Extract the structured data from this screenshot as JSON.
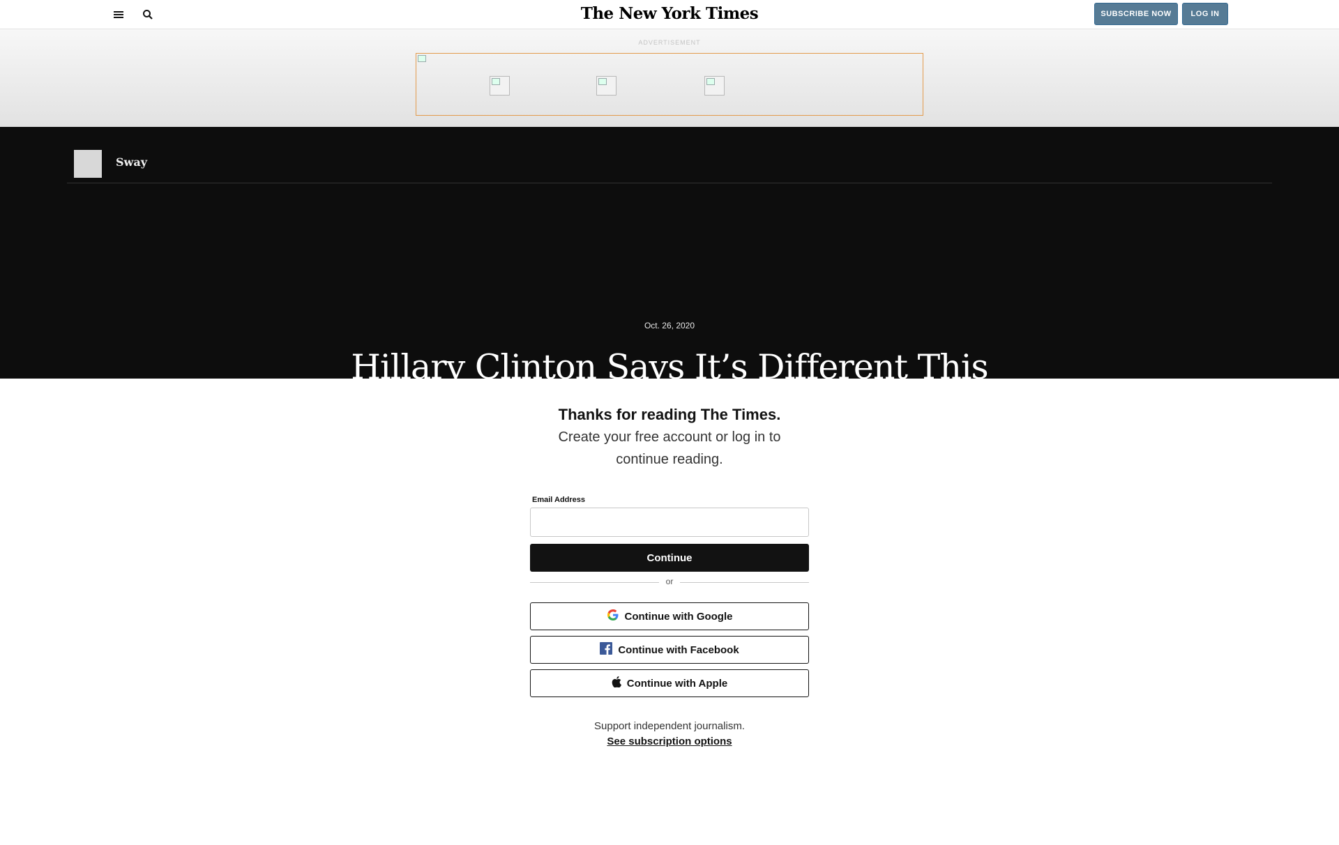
{
  "header": {
    "logo": "The New York Times",
    "subscribe_label": "SUBSCRIBE NOW",
    "login_label": "LOG IN",
    "menu_icon": "hamburger-menu-icon",
    "search_icon": "magnifier-icon"
  },
  "ad": {
    "label": "ADVERTISEMENT"
  },
  "hero": {
    "column_name": "Sway",
    "date": "Oct. 26, 2020",
    "headline": "Hillary Clinton Says It’s Different This"
  },
  "regwall": {
    "title": "Thanks for reading The Times.",
    "subtitle": "Create your free account or log in to continue reading.",
    "email_label": "Email Address",
    "email_value": "",
    "continue_label": "Continue",
    "or_label": "or",
    "google_label": "Continue with Google",
    "facebook_label": "Continue with Facebook",
    "apple_label": "Continue with Apple",
    "support_text": "Support independent journalism.",
    "subscription_link": "See subscription options"
  },
  "colors": {
    "subscribe_bg": "#567b95",
    "hero_bg": "#0d0d0d",
    "continue_bg": "#121212",
    "facebook_blue": "#3b5998"
  }
}
